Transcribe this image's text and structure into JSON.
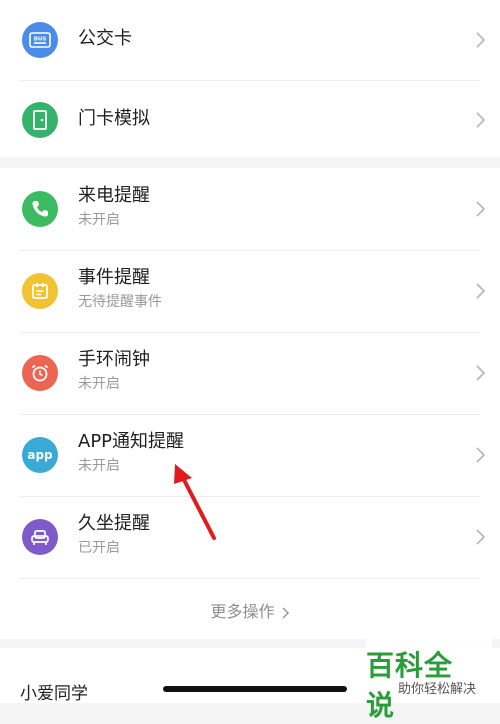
{
  "top_items": [
    {
      "label": "公交卡",
      "icon": "bus-card-icon",
      "color": "#4a8ce8"
    },
    {
      "label": "门卡模拟",
      "icon": "door-icon",
      "color": "#35b36a"
    }
  ],
  "reminder_items": [
    {
      "label": "来电提醒",
      "sub": "未开启",
      "icon": "phone-icon",
      "color": "#3dbb63"
    },
    {
      "label": "事件提醒",
      "sub": "无待提醒事件",
      "icon": "calendar-icon",
      "color": "#f3c233"
    },
    {
      "label": "手环闹钟",
      "sub": "未开启",
      "icon": "alarm-clock-icon",
      "color": "#ec6452"
    },
    {
      "label": "APP通知提醒",
      "sub": "未开启",
      "icon": "app-icon",
      "color": "#3ba9d5"
    },
    {
      "label": "久坐提醒",
      "sub": "已开启",
      "icon": "armchair-icon",
      "color": "#7d5bc8"
    }
  ],
  "more": {
    "label": "更多操作"
  },
  "xiaoai": {
    "label": "小爱同学"
  },
  "watermark": {
    "main": "百科全说",
    "sub": "助你轻松解决"
  },
  "colors": {
    "arrow": "#e11b1b",
    "watermark_green": "#2a9d3a"
  }
}
